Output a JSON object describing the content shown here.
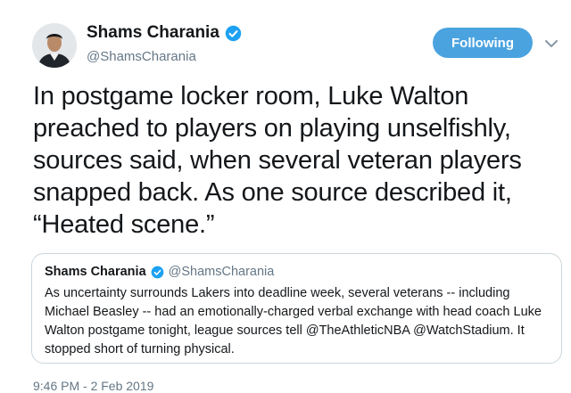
{
  "author": {
    "name": "Shams Charania",
    "handle": "@ShamsCharania",
    "verified": true
  },
  "follow_button": {
    "label": "Following"
  },
  "tweet": {
    "text": "In postgame locker room, Luke Walton preached to players on playing unselfishly, sources said, when several veteran players snapped back. As one source described it, “Heated scene.”"
  },
  "quoted_tweet": {
    "name": "Shams Charania",
    "handle": "@ShamsCharania",
    "verified": true,
    "text": "As uncertainty surrounds Lakers into deadline week, several veterans -- including Michael Beasley -- had an emotionally-charged verbal exchange with head coach Luke Walton postgame tonight, league sources tell @TheAthleticNBA @WatchStadium. It stopped short of turning physical."
  },
  "timestamp": "9:46 PM - 2 Feb 2019",
  "colors": {
    "accent": "#1da1f2",
    "follow_button_bg": "#4aa3df",
    "secondary_text": "#657786",
    "border": "#ccd6dd"
  },
  "icons": {
    "verified": "verified-badge-icon",
    "caret": "chevron-down-icon"
  }
}
